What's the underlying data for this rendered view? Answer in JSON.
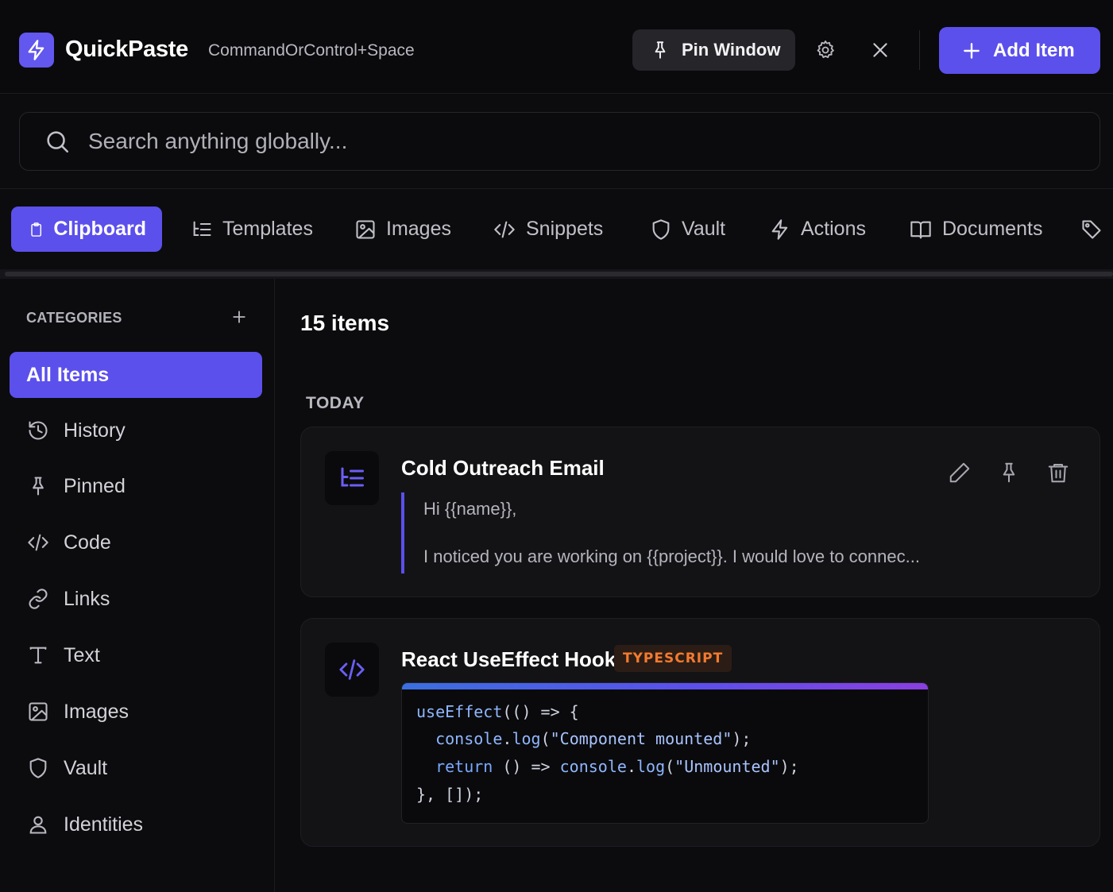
{
  "header": {
    "app_title": "QuickPaste",
    "shortcut": "CommandOrControl+Space",
    "pin_label": "Pin Window",
    "add_label": "Add Item"
  },
  "search": {
    "placeholder": "Search anything globally..."
  },
  "tabs": [
    {
      "label": "Clipboard",
      "icon": "clipboard-icon",
      "active": true
    },
    {
      "label": "Templates",
      "icon": "templates-icon"
    },
    {
      "label": "Images",
      "icon": "image-icon"
    },
    {
      "label": "Snippets",
      "icon": "code-icon"
    },
    {
      "label": "Vault",
      "icon": "shield-icon"
    },
    {
      "label": "Actions",
      "icon": "lightning-icon"
    },
    {
      "label": "Documents",
      "icon": "book-icon"
    },
    {
      "label": "",
      "icon": "tag-icon"
    }
  ],
  "sidebar": {
    "title": "CATEGORIES",
    "items": [
      {
        "label": "All Items",
        "active": true
      },
      {
        "label": "History",
        "icon": "history-icon"
      },
      {
        "label": "Pinned",
        "icon": "pin-icon"
      },
      {
        "label": "Code",
        "icon": "code-icon"
      },
      {
        "label": "Links",
        "icon": "link-icon"
      },
      {
        "label": "Text",
        "icon": "text-icon"
      },
      {
        "label": "Images",
        "icon": "image-icon"
      },
      {
        "label": "Vault",
        "icon": "shield-icon"
      },
      {
        "label": "Identities",
        "icon": "user-icon"
      }
    ]
  },
  "main": {
    "count": "15 items",
    "section": "TODAY",
    "cards": [
      {
        "title": "Cold Outreach Email",
        "icon": "templates-icon",
        "lines": [
          "Hi {{name}},",
          "I noticed you are working on {{project}}. I would love to connec..."
        ]
      },
      {
        "title": "React UseEffect Hook",
        "icon": "code-icon",
        "badge": "TYPESCRIPT",
        "code": [
          "useEffect(() => {",
          "  console.log(\"Component mounted\");",
          "  return () => console.log(\"Unmounted\");",
          "}, []);"
        ]
      }
    ]
  },
  "colors": {
    "accent": "#5b50ec",
    "background": "#0c0c0e",
    "card": "#131316",
    "badge_text": "#f37a2f"
  }
}
